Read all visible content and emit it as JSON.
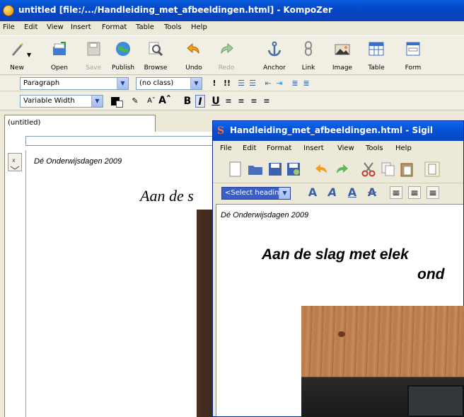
{
  "kompozer": {
    "title": "untitled [file:/.../Handleiding_met_afbeeldingen.html] - KompoZer",
    "menu": [
      "File",
      "Edit",
      "View",
      "Insert",
      "Format",
      "Table",
      "Tools",
      "Help"
    ],
    "toolbar": [
      {
        "label": "New",
        "icon": "new-page-icon"
      },
      {
        "label": "Open",
        "icon": "open-folder-icon"
      },
      {
        "label": "Save",
        "icon": "save-disk-icon"
      },
      {
        "label": "Publish",
        "icon": "publish-globe-icon"
      },
      {
        "label": "Browse",
        "icon": "browse-magnifier-icon"
      },
      {
        "label": "Undo",
        "icon": "undo-arrow-icon"
      },
      {
        "label": "Redo",
        "icon": "redo-arrow-icon"
      },
      {
        "label": "Anchor",
        "icon": "anchor-icon"
      },
      {
        "label": "Link",
        "icon": "link-chain-icon"
      },
      {
        "label": "Image",
        "icon": "image-icon"
      },
      {
        "label": "Table",
        "icon": "table-icon"
      },
      {
        "label": "Form",
        "icon": "form-icon"
      }
    ],
    "format1": {
      "paragraph_select": "Paragraph",
      "class_select": "(no class)"
    },
    "format2": {
      "width_select": "Variable Width"
    },
    "tab_label": "(untitled)",
    "document": {
      "header": "Dé Onderwijsdagen 2009",
      "title": "Aan de s"
    }
  },
  "sigil": {
    "title": "Handleiding_met_afbeeldingen.html - Sigil",
    "menu": [
      "File",
      "Edit",
      "Format",
      "Insert",
      "View",
      "Tools",
      "Help"
    ],
    "heading_select": "<Select heading>",
    "document": {
      "header": "Dé Onderwijsdagen 2009",
      "title_line1": "Aan de slag met elek",
      "title_line2": "ond"
    }
  },
  "colors": {
    "xp_title_blue": "#0548c8",
    "xp_chrome": "#ece9d8",
    "accent_orange": "#e08e00"
  }
}
